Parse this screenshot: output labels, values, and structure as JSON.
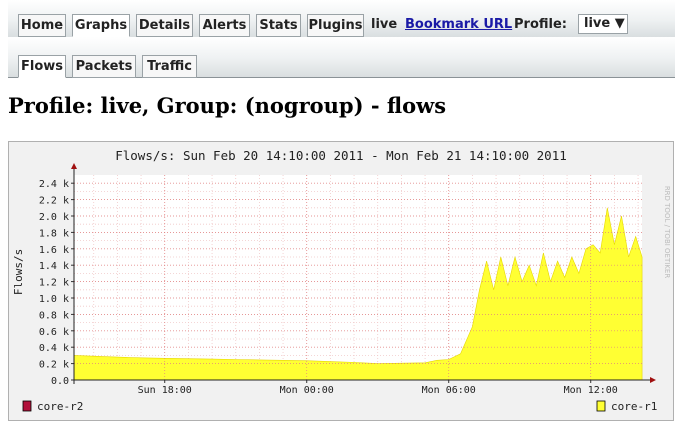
{
  "nav": {
    "tabs": [
      "Home",
      "Graphs",
      "Details",
      "Alerts",
      "Stats",
      "Plugins"
    ],
    "active_tab": "Graphs",
    "live_label": "live",
    "bookmark_label": "Bookmark URL",
    "profile_label": "Profile:",
    "profile_select": "live ▼"
  },
  "subnav": {
    "tabs": [
      "Flows",
      "Packets",
      "Traffic"
    ],
    "active_tab": "Flows"
  },
  "page_title": "Profile: live, Group: (nogroup) - flows",
  "chart_data": {
    "type": "area",
    "title": "Flows/s: Sun Feb 20 14:10:00 2011 - Mon Feb 21 14:10:00 2011",
    "ylabel": "Flows/s",
    "xlabel": "",
    "ylim": [
      0,
      2500
    ],
    "y_ticks": [
      "0.0",
      "0.2 k",
      "0.4 k",
      "0.6 k",
      "0.8 k",
      "1.0 k",
      "1.2 k",
      "1.4 k",
      "1.6 k",
      "1.8 k",
      "2.0 k",
      "2.2 k",
      "2.4 k"
    ],
    "x_ticks": [
      "Sun 18:00",
      "Mon 00:00",
      "Mon 06:00",
      "Mon 12:00"
    ],
    "x_tick_hours": [
      18,
      24,
      30,
      36
    ],
    "x_range_hours": [
      14.1667,
      38.1667
    ],
    "side_label": "RRD TOOL / TOBI OETIKER",
    "grid": true,
    "series": [
      {
        "name": "core-r2",
        "color": "#b0103a",
        "values": []
      },
      {
        "name": "core-r1",
        "color": "#ffff33",
        "x_hours": [
          14.17,
          15,
          16,
          17,
          18,
          19,
          20,
          21,
          22,
          23,
          24,
          25,
          26,
          27,
          28,
          29,
          29.5,
          30,
          30.5,
          31,
          31.3,
          31.6,
          31.9,
          32.2,
          32.5,
          32.8,
          33.1,
          33.4,
          33.7,
          34,
          34.3,
          34.6,
          34.9,
          35.2,
          35.5,
          35.8,
          36.1,
          36.4,
          36.7,
          37,
          37.3,
          37.6,
          37.9,
          38.17
        ],
        "values": [
          300,
          290,
          280,
          270,
          265,
          260,
          255,
          250,
          245,
          240,
          235,
          225,
          215,
          200,
          205,
          210,
          240,
          250,
          320,
          650,
          1100,
          1450,
          1100,
          1500,
          1150,
          1500,
          1200,
          1400,
          1150,
          1550,
          1200,
          1450,
          1250,
          1500,
          1300,
          1600,
          1650,
          1550,
          2100,
          1650,
          2000,
          1500,
          1750,
          1500
        ]
      }
    ],
    "legend": [
      "core-r2",
      "core-r1"
    ]
  }
}
